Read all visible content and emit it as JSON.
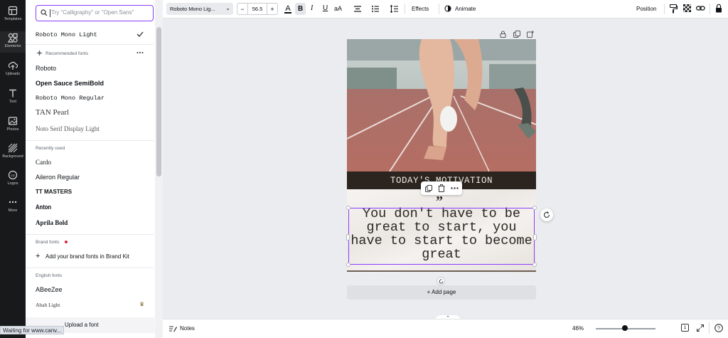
{
  "rail": [
    {
      "label": "Templates",
      "icon": "templates-icon"
    },
    {
      "label": "Elements",
      "icon": "elements-icon"
    },
    {
      "label": "Uploads",
      "icon": "uploads-icon"
    },
    {
      "label": "Text",
      "icon": "text-icon"
    },
    {
      "label": "Photos",
      "icon": "photos-icon"
    },
    {
      "label": "Background",
      "icon": "background-icon"
    },
    {
      "label": "Logos",
      "icon": "logos-icon"
    },
    {
      "label": "More",
      "icon": "more-icon"
    }
  ],
  "panel": {
    "search_placeholder": "Try \"Calligraphy\" or \"Open Sans\"",
    "current_font": "Roboto Mono Light",
    "recommended_header": "Recommended fonts",
    "recommended": [
      "Roboto",
      "Open Sauce SemiBold",
      "Roboto Mono Regular",
      "TAN Pearl",
      "Noto Serif Display Light"
    ],
    "recent_header": "Recently used",
    "recent": [
      "Cardo",
      "Aileron Regular",
      "TT MASTERS",
      "Anton",
      "Aprila Bold"
    ],
    "brand_header": "Brand fonts",
    "brand_add": "Add your brand fonts in Brand Kit",
    "english_header": "English fonts",
    "english": [
      "ABeeZee",
      "Abah Light"
    ],
    "upload_label": "Upload a font"
  },
  "status_bar": "Waiting for www.canv...",
  "toolbar": {
    "font_name": "Roboto Mono Lig...",
    "font_size": "56.5",
    "minus": "−",
    "plus": "+",
    "effects": "Effects",
    "animate": "Animate",
    "position": "Position"
  },
  "design": {
    "banner": "TODAY'S MOTIVATION",
    "quote_mark": "”",
    "quote_lines": [
      "You don't have to be",
      "great to start, you",
      "have to start to become",
      "great"
    ],
    "add_page": "+ Add page"
  },
  "bottom": {
    "notes": "Notes",
    "zoom": "46%",
    "page_count": "1",
    "zoom_fraction": 0.46
  },
  "colors": {
    "accent": "#8b3dff",
    "rail_bg": "#18191b",
    "banner_bg": "#2b241f"
  }
}
